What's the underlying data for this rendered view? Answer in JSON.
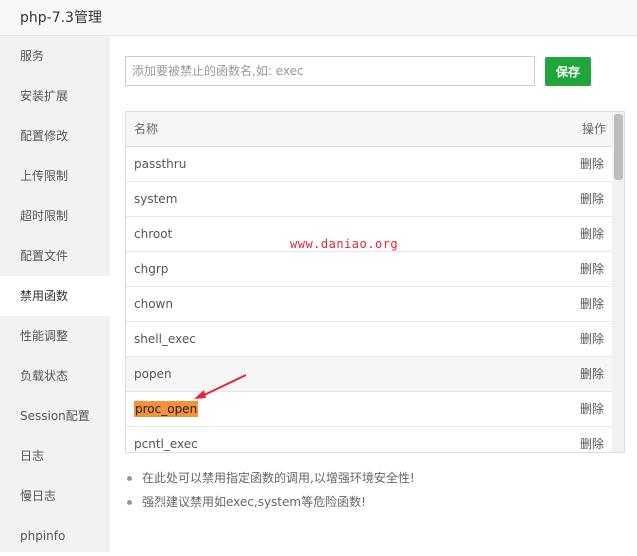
{
  "window": {
    "title": "php-7.3管理"
  },
  "sidebar": {
    "items": [
      {
        "label": "服务",
        "active": false
      },
      {
        "label": "安装扩展",
        "active": false
      },
      {
        "label": "配置修改",
        "active": false
      },
      {
        "label": "上传限制",
        "active": false
      },
      {
        "label": "超时限制",
        "active": false
      },
      {
        "label": "配置文件",
        "active": false
      },
      {
        "label": "禁用函数",
        "active": true
      },
      {
        "label": "性能调整",
        "active": false
      },
      {
        "label": "负载状态",
        "active": false
      },
      {
        "label": "Session配置",
        "active": false
      },
      {
        "label": "日志",
        "active": false
      },
      {
        "label": "慢日志",
        "active": false
      },
      {
        "label": "phpinfo",
        "active": false
      }
    ]
  },
  "form": {
    "placeholder": "添加要被禁止的函数名,如: exec",
    "value": "",
    "save_label": "保存"
  },
  "table": {
    "headers": {
      "name": "名称",
      "action": "操作"
    },
    "rows": [
      {
        "name": "passthru",
        "action": "删除",
        "shaded": false,
        "highlighted": false
      },
      {
        "name": "system",
        "action": "删除",
        "shaded": false,
        "highlighted": false
      },
      {
        "name": "chroot",
        "action": "删除",
        "shaded": false,
        "highlighted": false
      },
      {
        "name": "chgrp",
        "action": "删除",
        "shaded": false,
        "highlighted": false
      },
      {
        "name": "chown",
        "action": "删除",
        "shaded": false,
        "highlighted": false
      },
      {
        "name": "shell_exec",
        "action": "删除",
        "shaded": false,
        "highlighted": false
      },
      {
        "name": "popen",
        "action": "删除",
        "shaded": true,
        "highlighted": false
      },
      {
        "name": "proc_open",
        "action": "删除",
        "shaded": false,
        "highlighted": true
      },
      {
        "name": "pcntl_exec",
        "action": "删除",
        "shaded": false,
        "highlighted": false
      }
    ]
  },
  "watermark": "www.daniao.org",
  "tips": [
    "在此处可以禁用指定函数的调用,以增强环境安全性!",
    "强烈建议禁用如exec,system等危险函数!"
  ],
  "colors": {
    "accent": "#20a53a",
    "highlight": "#f3923a",
    "annotation": "#e8243a"
  }
}
